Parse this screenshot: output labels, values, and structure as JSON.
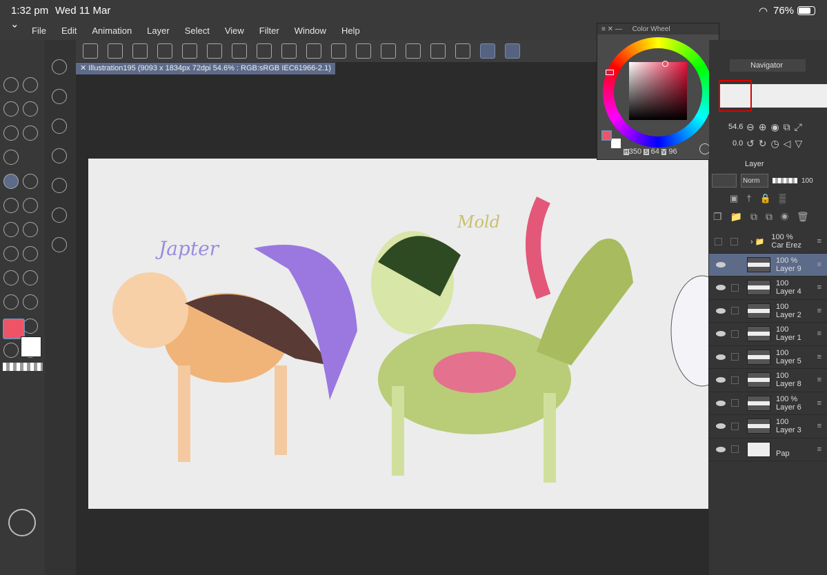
{
  "status": {
    "time": "1:32 pm",
    "date": "Wed 11 Mar",
    "battery": "76%"
  },
  "menu": [
    "File",
    "Edit",
    "Animation",
    "Layer",
    "Select",
    "View",
    "Filter",
    "Window",
    "Help"
  ],
  "document_tab": "Illustration195 (9093 x 1834px 72dpi 54.6% : RGB:sRGB IEC61966-2.1)",
  "color_wheel": {
    "title": "Color Wheel",
    "h_label": "H",
    "h": "350",
    "s_label": "S",
    "s": "64",
    "v_label": "V",
    "v": "96",
    "main_color": "#ef5466",
    "sub_color": "#ffffff"
  },
  "navigator": {
    "title": "Navigator",
    "zoom": "54.6",
    "rotation": "0.0"
  },
  "layer_panel": {
    "title": "Layer",
    "blend": "Norm",
    "opacity": "100",
    "layers": [
      {
        "opacity": "100 %",
        "name": "Car Erez",
        "folder": true
      },
      {
        "opacity": "100 %",
        "name": "Layer 9",
        "selected": true
      },
      {
        "opacity": "100",
        "name": "Layer 4"
      },
      {
        "opacity": "100",
        "name": "Layer 2"
      },
      {
        "opacity": "100",
        "name": "Layer 1"
      },
      {
        "opacity": "100",
        "name": "Layer 5"
      },
      {
        "opacity": "100",
        "name": "Layer 8"
      },
      {
        "opacity": "100 %",
        "name": "Layer 6"
      },
      {
        "opacity": "100",
        "name": "Layer 3"
      },
      {
        "opacity": "",
        "name": "Pap"
      }
    ]
  },
  "canvas": {
    "label1": "Japter",
    "label2": "Mold"
  }
}
